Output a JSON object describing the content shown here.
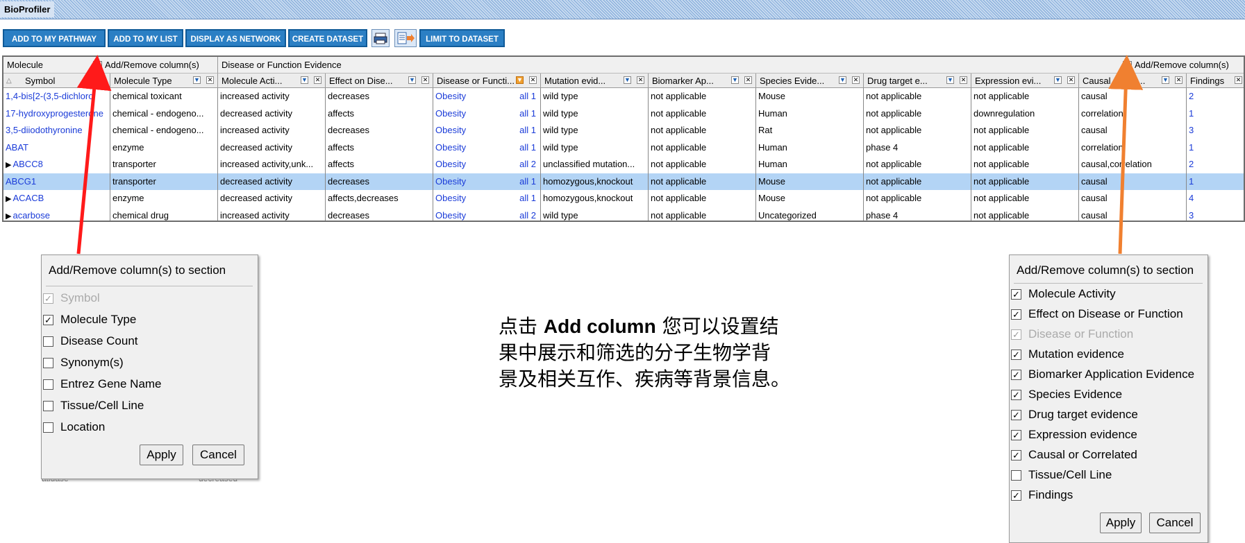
{
  "app": {
    "title": "BioProfiler"
  },
  "toolbar": {
    "buttons": [
      "ADD TO MY PATHWAY",
      "ADD TO MY LIST",
      "DISPLAY AS NETWORK",
      "CREATE DATASET",
      "LIMIT TO DATASET"
    ],
    "icons": [
      "print-icon",
      "export-icon"
    ]
  },
  "grid": {
    "section_molecule": "Molecule",
    "section_disease": "Disease or Function Evidence",
    "add_remove_label": "Add/Remove column(s)",
    "columns": [
      "Symbol",
      "Molecule Type",
      "Molecule Acti...",
      "Effect on Dise...",
      "Disease or Functi...",
      "Mutation evid...",
      "Biomarker Ap...",
      "Species Evide...",
      "Drug target e...",
      "Expression evi...",
      "Causal or Cor...",
      "Findings"
    ],
    "rows": [
      {
        "expand": false,
        "symbol": "1,4-bis[2-(3,5-dichloro",
        "type": "chemical toxicant",
        "activity": "increased activity",
        "effect": "decreases",
        "disease": "Obesity",
        "all": "all 1",
        "mutation": "wild type",
        "biomarker": "not applicable",
        "species": "Mouse",
        "drug": "not applicable",
        "expression": "not applicable",
        "causal": "causal",
        "findings": "2",
        "selected": false
      },
      {
        "expand": false,
        "symbol": "17-hydroxyprogesterone",
        "type": "chemical - endogeno...",
        "activity": "decreased activity",
        "effect": "affects",
        "disease": "Obesity",
        "all": "all 1",
        "mutation": "wild type",
        "biomarker": "not applicable",
        "species": "Human",
        "drug": "not applicable",
        "expression": "downregulation",
        "causal": "correlation",
        "findings": "1",
        "selected": false
      },
      {
        "expand": false,
        "symbol": "3,5-diiodothyronine",
        "type": "chemical - endogeno...",
        "activity": "increased activity",
        "effect": "decreases",
        "disease": "Obesity",
        "all": "all 1",
        "mutation": "wild type",
        "biomarker": "not applicable",
        "species": "Rat",
        "drug": "not applicable",
        "expression": "not applicable",
        "causal": "causal",
        "findings": "3",
        "selected": false
      },
      {
        "expand": false,
        "symbol": "ABAT",
        "type": "enzyme",
        "activity": "decreased activity",
        "effect": "affects",
        "disease": "Obesity",
        "all": "all 1",
        "mutation": "wild type",
        "biomarker": "not applicable",
        "species": "Human",
        "drug": "phase 4",
        "expression": "not applicable",
        "causal": "correlation",
        "findings": "1",
        "selected": false
      },
      {
        "expand": true,
        "symbol": "ABCC8",
        "type": "transporter",
        "activity": "increased activity,unk...",
        "effect": "affects",
        "disease": "Obesity",
        "all": "all 2",
        "mutation": "unclassified mutation...",
        "biomarker": "not applicable",
        "species": "Human",
        "drug": "not applicable",
        "expression": "not applicable",
        "causal": "causal,correlation",
        "findings": "2",
        "selected": false
      },
      {
        "expand": false,
        "symbol": "ABCG1",
        "type": "transporter",
        "activity": "decreased activity",
        "effect": "decreases",
        "disease": "Obesity",
        "all": "all 1",
        "mutation": "homozygous,knockout",
        "biomarker": "not applicable",
        "species": "Mouse",
        "drug": "not applicable",
        "expression": "not applicable",
        "causal": "causal",
        "findings": "1",
        "selected": true
      },
      {
        "expand": true,
        "symbol": "ACACB",
        "type": "enzyme",
        "activity": "decreased activity",
        "effect": "affects,decreases",
        "disease": "Obesity",
        "all": "all 1",
        "mutation": "homozygous,knockout",
        "biomarker": "not applicable",
        "species": "Mouse",
        "drug": "not applicable",
        "expression": "not applicable",
        "causal": "causal",
        "findings": "4",
        "selected": false
      },
      {
        "expand": true,
        "symbol": "acarbose",
        "type": "chemical drug",
        "activity": "increased activity",
        "effect": "decreases",
        "disease": "Obesity",
        "all": "all 2",
        "mutation": "wild type",
        "biomarker": "not applicable",
        "species": "Uncategorized",
        "drug": "phase 4",
        "expression": "not applicable",
        "causal": "causal",
        "findings": "3",
        "selected": false
      }
    ]
  },
  "dialog_left": {
    "title": "Add/Remove column(s) to section",
    "items": [
      {
        "label": "Symbol",
        "checked": true,
        "disabled": true
      },
      {
        "label": "Molecule Type",
        "checked": true,
        "disabled": false
      },
      {
        "label": "Disease Count",
        "checked": false,
        "disabled": false
      },
      {
        "label": "Synonym(s)",
        "checked": false,
        "disabled": false
      },
      {
        "label": "Entrez Gene Name",
        "checked": false,
        "disabled": false
      },
      {
        "label": "Tissue/Cell Line",
        "checked": false,
        "disabled": false
      },
      {
        "label": "Location",
        "checked": false,
        "disabled": false
      }
    ],
    "apply": "Apply",
    "cancel": "Cancel"
  },
  "dialog_right": {
    "title": "Add/Remove column(s) to section",
    "items": [
      {
        "label": "Molecule Activity",
        "checked": true,
        "disabled": false
      },
      {
        "label": "Effect on Disease or Function",
        "checked": true,
        "disabled": false
      },
      {
        "label": "Disease or Function",
        "checked": true,
        "disabled": true
      },
      {
        "label": "Mutation evidence",
        "checked": true,
        "disabled": false
      },
      {
        "label": "Biomarker Application Evidence",
        "checked": true,
        "disabled": false
      },
      {
        "label": "Species Evidence",
        "checked": true,
        "disabled": false
      },
      {
        "label": "Drug target evidence",
        "checked": true,
        "disabled": false
      },
      {
        "label": "Expression evidence",
        "checked": true,
        "disabled": false
      },
      {
        "label": "Causal or Correlated",
        "checked": true,
        "disabled": false
      },
      {
        "label": "Tissue/Cell Line",
        "checked": false,
        "disabled": false
      },
      {
        "label": "Findings",
        "checked": true,
        "disabled": false
      }
    ],
    "apply": "Apply",
    "cancel": "Cancel"
  },
  "annotation": {
    "prefix": "点击 ",
    "bold": "Add column",
    "line1_rest": " 您可以设置结",
    "line2": "果中展示和筛选的分子生物学背",
    "line3": "景及相关互作、疾病等背景信息。"
  },
  "colors": {
    "arrow_left": "#ff1a1a",
    "arrow_right": "#f08030",
    "selected_row": "#b3d4f5",
    "link": "#1a3bd8",
    "toolbar_button": "#2b7fc4"
  },
  "stray_text": [
    "atidase",
    "decreased"
  ]
}
